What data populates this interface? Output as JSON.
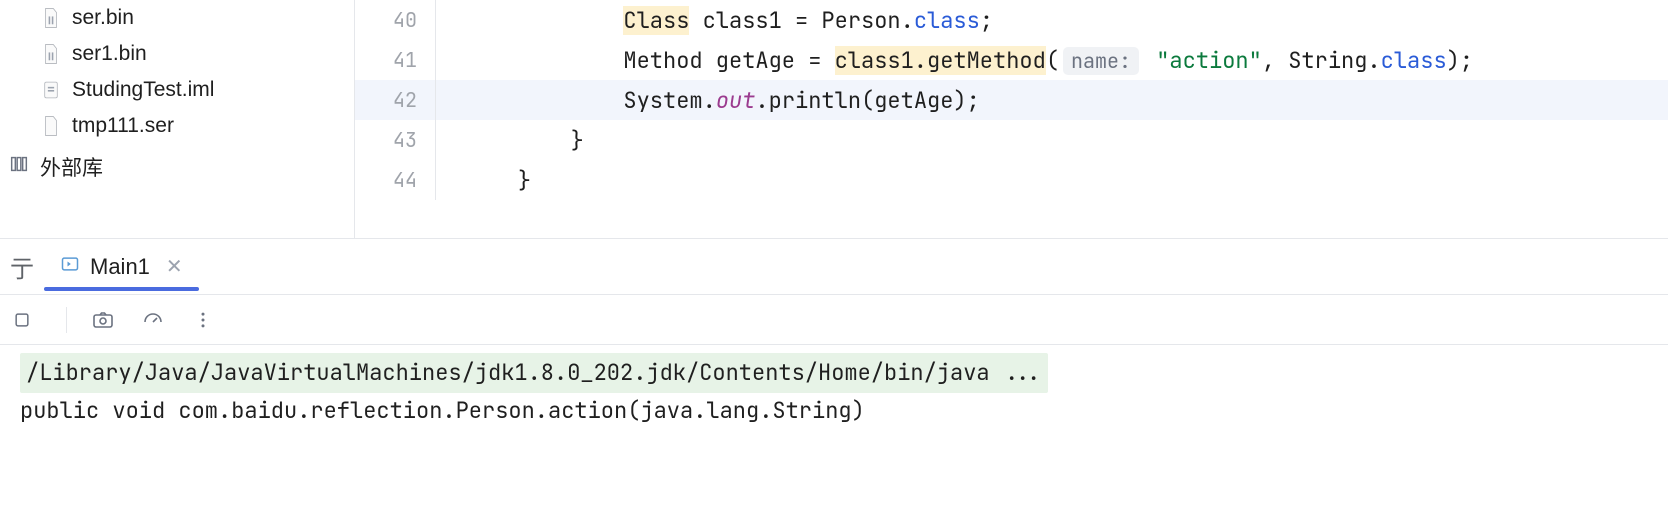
{
  "sidebar": {
    "files": [
      {
        "name": "ser.bin",
        "icon": "binary-file"
      },
      {
        "name": "ser1.bin",
        "icon": "binary-file"
      },
      {
        "name": "StudingTest.iml",
        "icon": "iml-file"
      },
      {
        "name": "tmp111.ser",
        "icon": "generic-file"
      }
    ],
    "external_lib_label": "外部库"
  },
  "editor": {
    "lines": [
      {
        "num": "40",
        "indent": "            ",
        "tokens": [
          {
            "t": "Class",
            "cls": "hl-class"
          },
          {
            "t": " class1 = Person.",
            "cls": ""
          },
          {
            "t": "class",
            "cls": "k-blue"
          },
          {
            "t": ";",
            "cls": ""
          }
        ]
      },
      {
        "num": "41",
        "indent": "            ",
        "tokens": [
          {
            "t": "Method getAge = ",
            "cls": ""
          },
          {
            "t": "class1.getMethod",
            "cls": "hl-call"
          },
          {
            "t": "(",
            "cls": ""
          },
          {
            "t": "name:",
            "cls": "param-hint"
          },
          {
            "t": " ",
            "cls": ""
          },
          {
            "t": "\"action\"",
            "cls": "k-green"
          },
          {
            "t": ", String.",
            "cls": ""
          },
          {
            "t": "class",
            "cls": "k-blue"
          },
          {
            "t": ");",
            "cls": ""
          }
        ]
      },
      {
        "num": "42",
        "indent": "            ",
        "current": true,
        "tokens": [
          {
            "t": "System.",
            "cls": ""
          },
          {
            "t": "out",
            "cls": "k-purple"
          },
          {
            "t": ".println(getAge);",
            "cls": ""
          }
        ]
      },
      {
        "num": "43",
        "indent": "        ",
        "tokens": [
          {
            "t": "}",
            "cls": ""
          }
        ]
      },
      {
        "num": "44",
        "indent": "    ",
        "tokens": [
          {
            "t": "}",
            "cls": ""
          }
        ]
      }
    ]
  },
  "run": {
    "tab_label": "Main1",
    "console": {
      "cmd": "/Library/Java/JavaVirtualMachines/jdk1.8.0_202.jdk/Contents/Home/bin/java ...",
      "out1": "public void com.baidu.reflection.Person.action(java.lang.String)"
    }
  }
}
